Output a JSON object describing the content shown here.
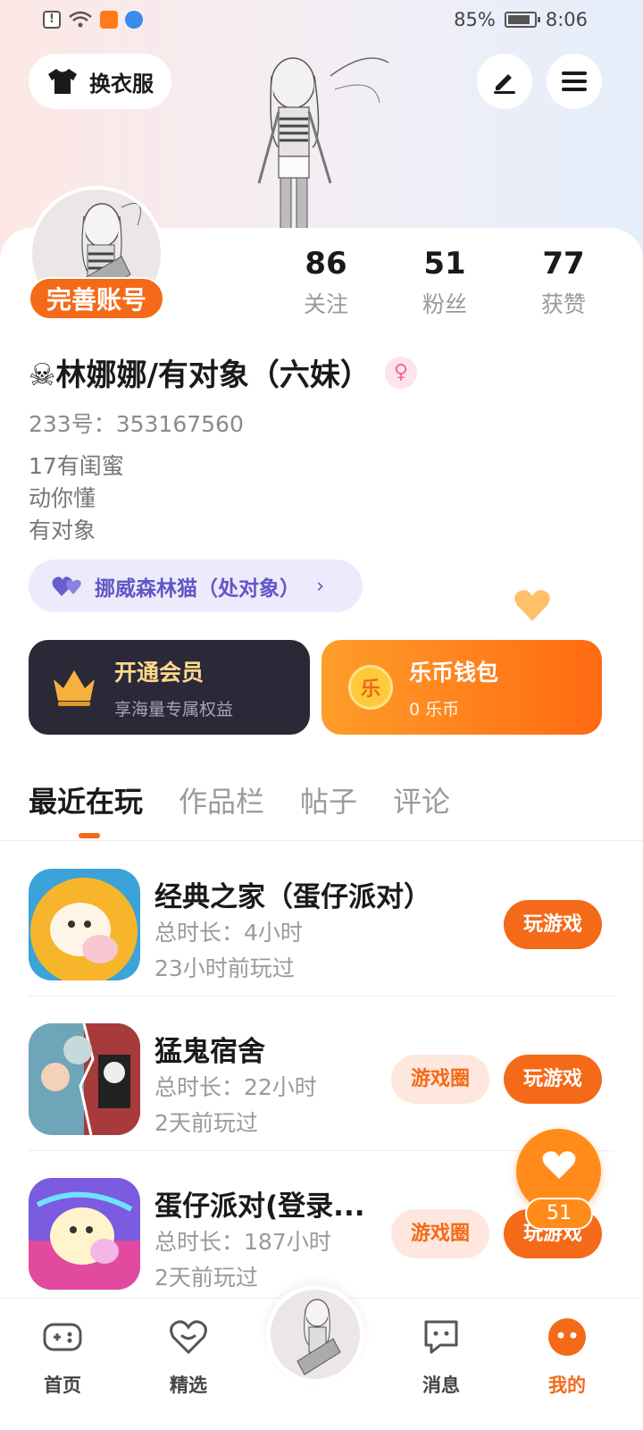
{
  "status_bar": {
    "battery": "85%",
    "time": "8:06"
  },
  "top_actions": {
    "outfit_label": "换衣服"
  },
  "profile": {
    "complete_label": "完善账号",
    "stats": [
      {
        "value": "86",
        "label": "关注"
      },
      {
        "value": "51",
        "label": "粉丝"
      },
      {
        "value": "77",
        "label": "获赞"
      }
    ],
    "name": "☠林娜娜/有对象（六妹）",
    "uid": "233号：353167560",
    "bio": [
      "17有闺蜜",
      "动你懂",
      "有对象"
    ],
    "relation": "挪威森林猫（处对象）"
  },
  "vip": {
    "title": "开通会员",
    "subtitle": "享海量专属权益"
  },
  "wallet": {
    "title": "乐币钱包",
    "subtitle": "0 乐币",
    "coin_glyph": "乐"
  },
  "tabs": [
    "最近在玩",
    "作品栏",
    "帖子",
    "评论"
  ],
  "games": [
    {
      "name": "经典之家（蛋仔派对）",
      "duration": "总时长：4小时",
      "last_played": "23小时前玩过",
      "has_circle": false
    },
    {
      "name": "猛鬼宿舍",
      "duration": "总时长：22小时",
      "last_played": "2天前玩过",
      "has_circle": true
    },
    {
      "name": "蛋仔派对(登录...",
      "duration": "总时长：187小时",
      "last_played": "2天前玩过",
      "has_circle": true
    }
  ],
  "game_buttons": {
    "play": "玩游戏",
    "circle": "游戏圈"
  },
  "floating_like": {
    "count": "51"
  },
  "bottom_nav": [
    {
      "label": "首页",
      "icon": "gamepad-icon"
    },
    {
      "label": "精选",
      "icon": "heart-outline-icon"
    },
    {
      "label": "消息",
      "icon": "chat-icon"
    },
    {
      "label": "我的",
      "icon": "profile-face-icon"
    }
  ],
  "colors": {
    "accent": "#f46a19",
    "vip_bg": "#2b2838",
    "relation_text": "#6455c7"
  }
}
